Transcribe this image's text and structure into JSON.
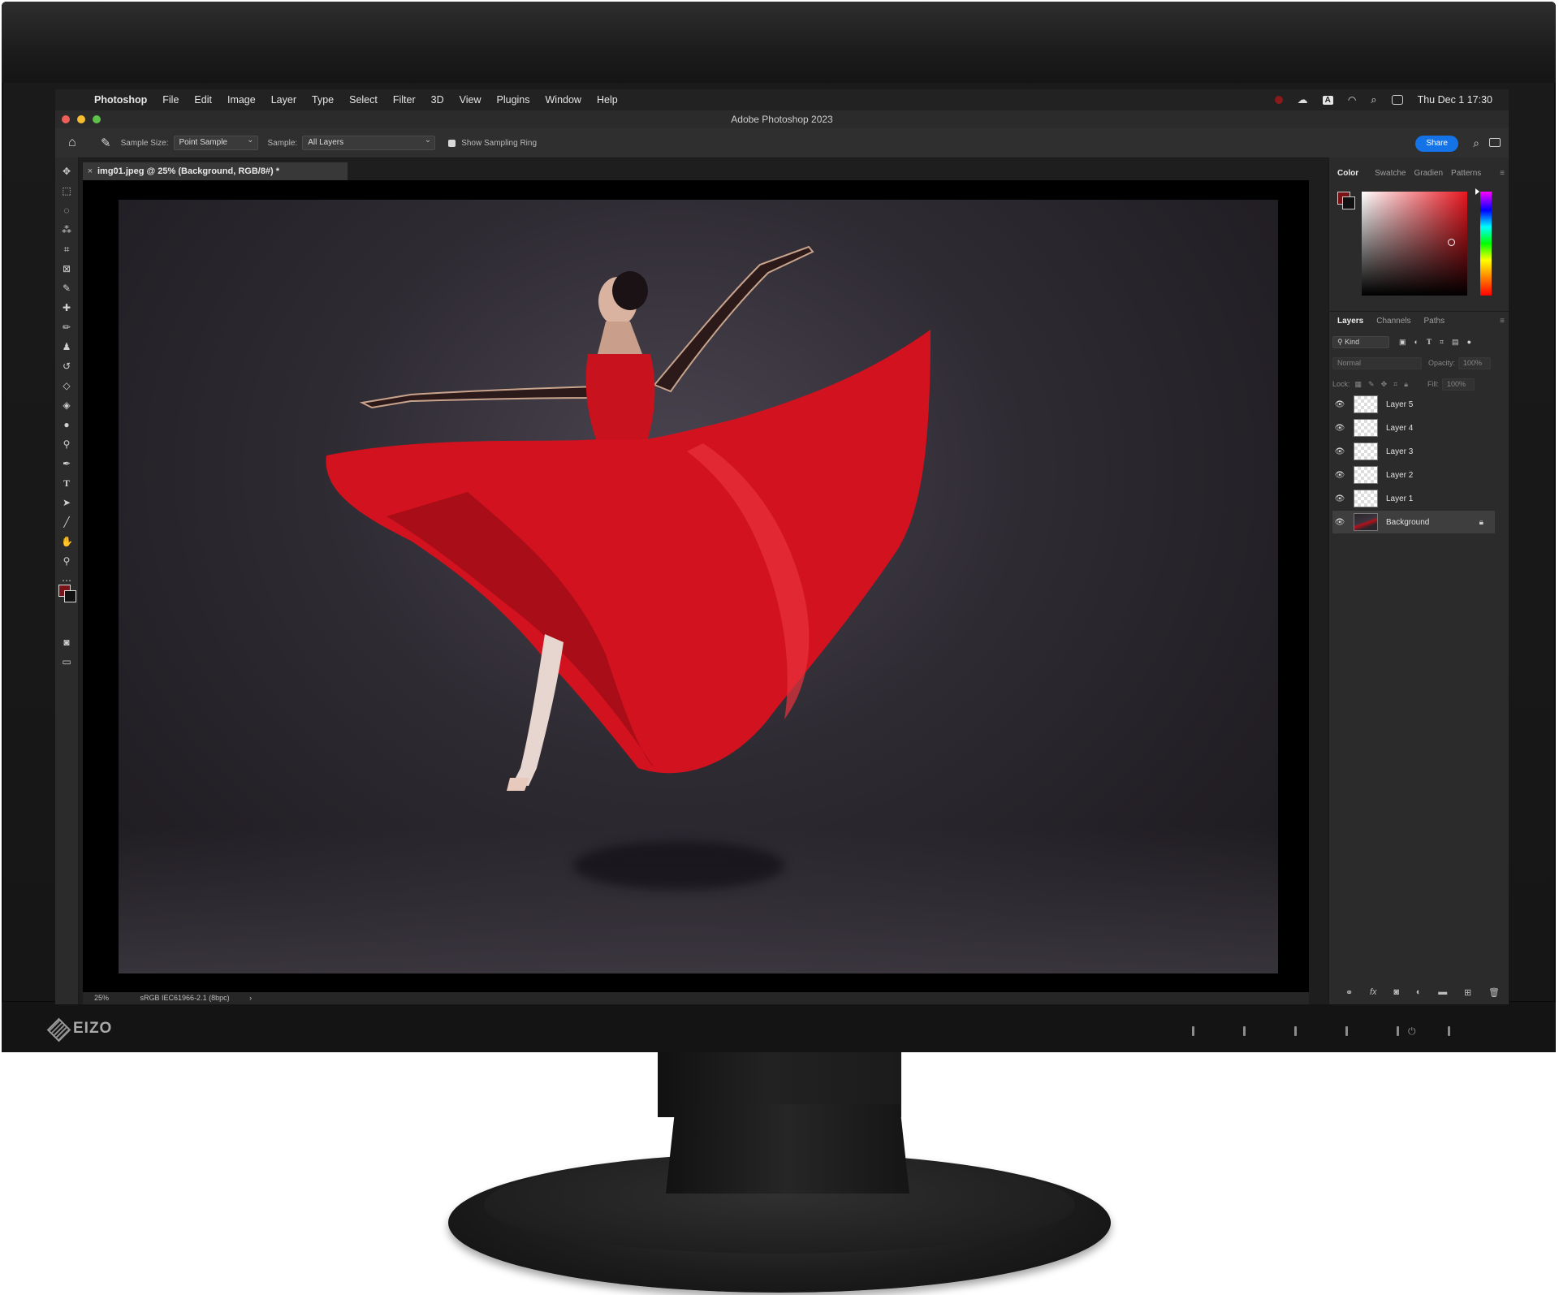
{
  "monitor": {
    "brand": "EIZO"
  },
  "menubar": {
    "app_name": "Photoshop",
    "items": [
      "File",
      "Edit",
      "Image",
      "Layer",
      "Type",
      "Select",
      "Filter",
      "3D",
      "View",
      "Plugins",
      "Window",
      "Help"
    ],
    "date_time": "Thu Dec 1  17:30",
    "input_source": "A"
  },
  "window": {
    "title": "Adobe Photoshop 2023"
  },
  "options_bar": {
    "sample_size_label": "Sample Size:",
    "sample_size_value": "Point Sample",
    "sample_label": "Sample:",
    "sample_value": "All Layers",
    "show_ring_label": "Show Sampling Ring",
    "show_ring_checked": true,
    "share_label": "Share"
  },
  "document": {
    "tab_title": "img01.jpeg @ 25% (Background, RGB/8#) *",
    "zoom": "25%",
    "profile": "sRGB IEC61966-2.1 (8bpc)"
  },
  "color_panel": {
    "tabs": [
      "Color",
      "Swatche",
      "Gradien",
      "Patterns"
    ],
    "active_tab": "Color",
    "foreground_color": "#7a1318",
    "background_color": "#111111"
  },
  "layers_panel": {
    "tabs": [
      "Layers",
      "Channels",
      "Paths"
    ],
    "active_tab": "Layers",
    "filter_kind": "Kind",
    "blend_mode": "Normal",
    "opacity_label": "Opacity:",
    "opacity_value": "100%",
    "lock_label": "Lock:",
    "fill_label": "Fill:",
    "fill_value": "100%",
    "layers": [
      {
        "name": "Layer 5",
        "visible": true
      },
      {
        "name": "Layer 4",
        "visible": true
      },
      {
        "name": "Layer 3",
        "visible": true
      },
      {
        "name": "Layer 2",
        "visible": true
      },
      {
        "name": "Layer 1",
        "visible": true
      },
      {
        "name": "Background",
        "visible": true,
        "locked": true,
        "selected": true
      }
    ]
  },
  "colors": {
    "share_blue": "#1473e6",
    "dress_red": "#d3121f"
  }
}
